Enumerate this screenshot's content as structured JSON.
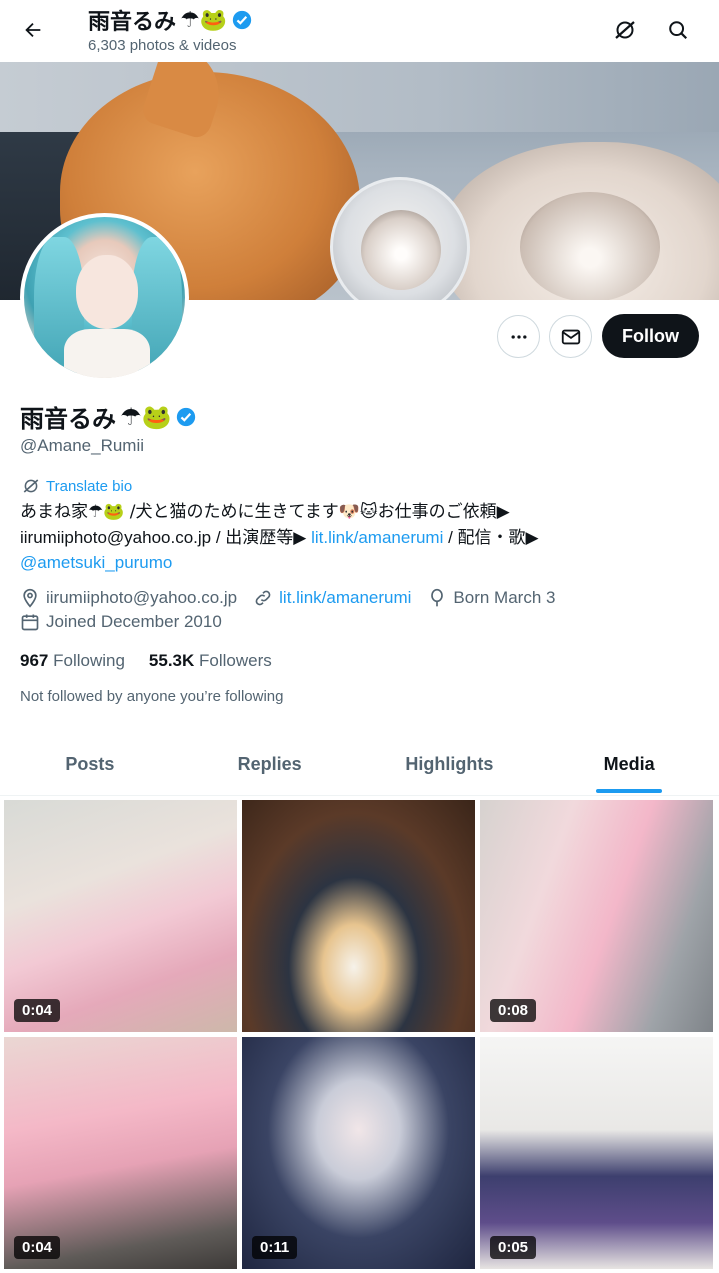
{
  "header": {
    "title": "雨音るみ",
    "title_emoji": "☂🐸",
    "subtitle": "6,303 photos & videos"
  },
  "profile": {
    "display_name": "雨音るみ",
    "name_emoji": "☂🐸",
    "handle": "@Amane_Rumii",
    "follow_label": "Follow",
    "translate_label": "Translate bio",
    "bio": {
      "line1": "あまね家☂🐸 /犬と猫のために生きてます🐶🐱お仕事のご依頼▶",
      "line2_prefix": "iirumiiphoto@yahoo.co.jp / 出演歴等▶ ",
      "line2_link": "lit.link/amanerumi",
      "line2_suffix": " / 配信・歌▶",
      "line3_link": "@ametsuki_purumo"
    },
    "location": "iirumiiphoto@yahoo.co.jp",
    "website": "lit.link/amanerumi",
    "birthday": "Born March 3",
    "joined": "Joined December 2010",
    "following_count": "967",
    "following_label": "Following",
    "followers_count": "55.3K",
    "followers_label": "Followers",
    "not_followed": "Not followed by anyone you’re following"
  },
  "tabs": [
    {
      "label": "Posts",
      "active": false
    },
    {
      "label": "Replies",
      "active": false
    },
    {
      "label": "Highlights",
      "active": false
    },
    {
      "label": "Media",
      "active": true
    }
  ],
  "media": [
    {
      "duration": "0:04"
    },
    {
      "duration": ""
    },
    {
      "duration": "0:08"
    },
    {
      "duration": "0:04"
    },
    {
      "duration": "0:11"
    },
    {
      "duration": "0:05"
    }
  ],
  "colors": {
    "accent": "#1d9bf0",
    "text": "#0f1419",
    "muted": "#536471",
    "follow_bg": "#0f1419"
  }
}
